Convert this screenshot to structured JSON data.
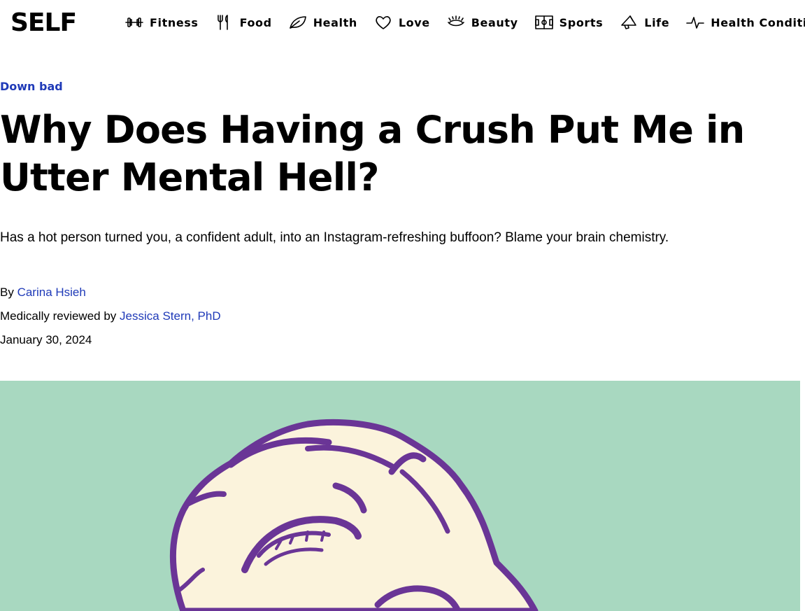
{
  "brand": {
    "logo": "SELF"
  },
  "nav": {
    "items": [
      {
        "label": "Fitness",
        "icon": "dumbbell-icon"
      },
      {
        "label": "Food",
        "icon": "fork-knife-icon"
      },
      {
        "label": "Health",
        "icon": "leaf-icon"
      },
      {
        "label": "Love",
        "icon": "heart-icon"
      },
      {
        "label": "Beauty",
        "icon": "eyelash-icon"
      },
      {
        "label": "Sports",
        "icon": "field-icon"
      },
      {
        "label": "Life",
        "icon": "megaphone-icon"
      },
      {
        "label": "Health Conditions",
        "icon": "pulse-icon"
      }
    ]
  },
  "article": {
    "kicker": "Down bad",
    "headline": "Why Does Having a Crush Put Me in Utter Mental Hell?",
    "dek": "Has a hot person turned you, a confident adult, into an Instagram-refreshing buffoon? Blame your brain chemistry.",
    "byline": {
      "by_prefix": "By",
      "author": "Carina Hsieh",
      "reviewed_prefix": "Medically reviewed by",
      "reviewer": "Jessica Stern, PhD",
      "date": "January 30, 2024"
    },
    "hero": {
      "background_color": "#a8d8c0",
      "face_color": "#fbf3dc",
      "line_color": "#6a3596"
    }
  },
  "colors": {
    "link": "#1f3ab8",
    "text": "#000000"
  }
}
